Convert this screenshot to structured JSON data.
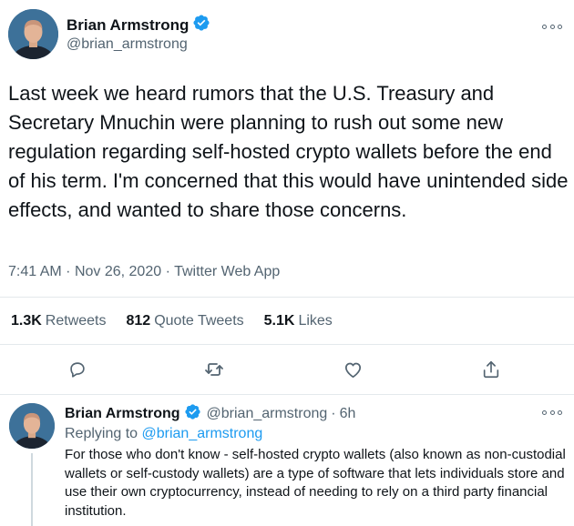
{
  "main_tweet": {
    "author_name": "Brian Armstrong",
    "author_handle": "@brian_armstrong",
    "text": "Last week we heard rumors that the U.S. Treasury and Secretary Mnuchin were planning to rush out some new regulation regarding self-hosted crypto wallets before the end of his term. I'm concerned that this would have unintended side effects, and wanted to share those concerns.",
    "time": "7:41 AM",
    "date": "Nov 26, 2020",
    "source": "Twitter Web App",
    "stats": {
      "retweets_count": "1.3K",
      "retweets_label": "Retweets",
      "quotes_count": "812",
      "quotes_label": "Quote Tweets",
      "likes_count": "5.1K",
      "likes_label": "Likes"
    }
  },
  "reply_tweet": {
    "author_name": "Brian Armstrong",
    "author_handle": "@brian_armstrong",
    "age": "6h",
    "replying_prefix": "Replying to",
    "replying_to": "@brian_armstrong",
    "text": "For those who don't know - self-hosted crypto wallets (also known as non-custodial wallets or self-custody wallets) are a type of software that lets individuals store and use their own cryptocurrency, instead of needing to rely on a third party financial institution."
  },
  "icons": {
    "verified": "verified-badge-icon",
    "more": "more-options-icon",
    "reply": "reply-icon",
    "retweet": "retweet-icon",
    "like": "heart-icon",
    "share": "share-icon"
  },
  "colors": {
    "accent": "#1d9bf0",
    "secondary_text": "#536471",
    "divider": "#e4e9ec"
  }
}
